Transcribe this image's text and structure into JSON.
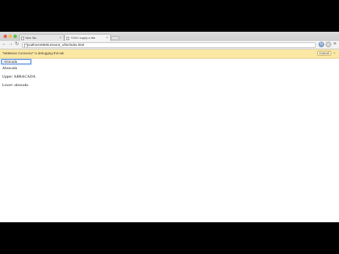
{
  "browser": {
    "tabs": [
      {
        "title": "New Tab",
        "active": false
      },
      {
        "title": "TODO supply a title",
        "active": true
      }
    ],
    "url": "localhost:8383/Lesson2_1/bin/index.html"
  },
  "infobar": {
    "message": "\"NetBeans Connector\" is debugging this tab",
    "cancel_label": "Cancel",
    "close_glyph": "×"
  },
  "page": {
    "input_value": "Abracada",
    "original": "Abracada",
    "upper": "Upper: ABRACADA",
    "lower": "Lower: abracada"
  },
  "icons": {
    "back": "back-arrow-icon",
    "forward": "forward-arrow-icon",
    "reload": "reload-icon",
    "menu": "hamburger-menu-icon"
  },
  "colors": {
    "infobar_bg": "#fbe8a4",
    "focus_ring": "#5b8ed9"
  }
}
